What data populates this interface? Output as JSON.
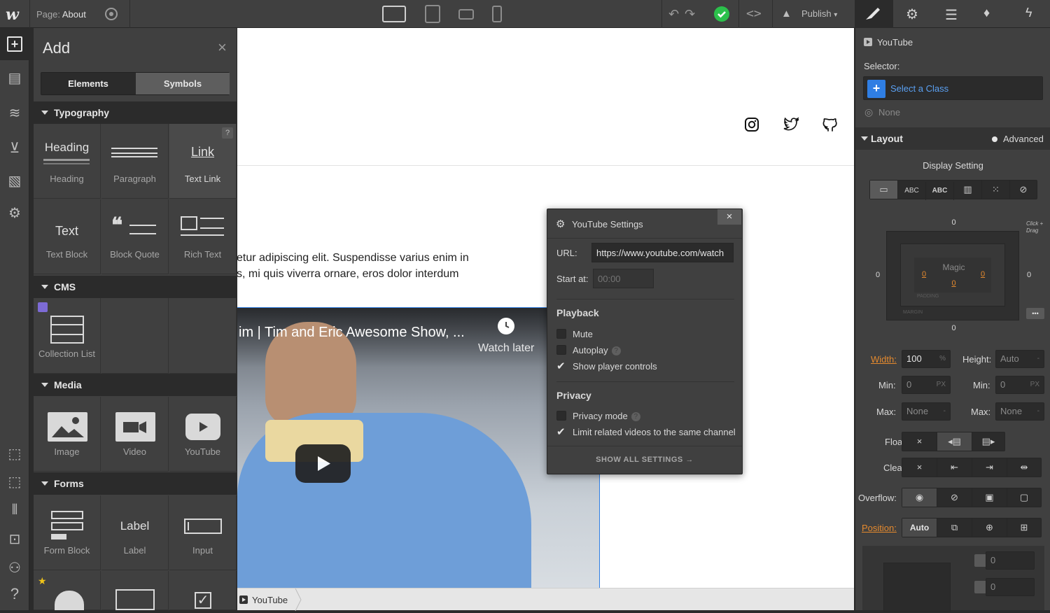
{
  "topbar": {
    "logo": "w",
    "page_prefix": "Page:",
    "page_name": "About",
    "publish_label": "Publish",
    "status_color": "#2bc04b"
  },
  "add_panel": {
    "title": "Add",
    "tabs": [
      "Elements",
      "Symbols"
    ],
    "help_badge": "?",
    "sections": {
      "typography": {
        "label": "Typography",
        "items": [
          {
            "visual": "Heading",
            "label": "Heading"
          },
          {
            "visual": "",
            "label": "Paragraph"
          },
          {
            "visual": "Link",
            "label": "Text Link"
          },
          {
            "visual": "Text",
            "label": "Text Block"
          },
          {
            "visual": "",
            "label": "Block Quote"
          },
          {
            "visual": "",
            "label": "Rich Text"
          }
        ]
      },
      "cms": {
        "label": "CMS",
        "items": [
          {
            "label": "Collection List"
          }
        ]
      },
      "media": {
        "label": "Media",
        "items": [
          {
            "label": "Image"
          },
          {
            "label": "Video"
          },
          {
            "label": "YouTube"
          }
        ]
      },
      "forms": {
        "label": "Forms",
        "items": [
          {
            "visual": "",
            "label": "Form Block"
          },
          {
            "visual": "Label",
            "label": "Label"
          },
          {
            "visual": "",
            "label": "Input"
          }
        ]
      }
    }
  },
  "canvas": {
    "paragraph_line1": "etur adipiscing elit. Suspendisse varius enim in",
    "paragraph_line2": "s, mi quis viverra ornare, eros dolor interdum",
    "video_title": "im | Tim and Eric Awesome Show, ...",
    "watch_later": "Watch later"
  },
  "breadcrumb": {
    "label": "YouTube"
  },
  "youtube_settings": {
    "title": "YouTube Settings",
    "url_label": "URL:",
    "url_value": "https://www.youtube.com/watch",
    "start_label": "Start at:",
    "start_placeholder": "00:00",
    "playback_heading": "Playback",
    "mute_label": "Mute",
    "autoplay_label": "Autoplay",
    "controls_label": "Show player controls",
    "privacy_heading": "Privacy",
    "privacy_mode_label": "Privacy mode",
    "limit_label": "Limit related videos to the same channel",
    "show_all_label": "SHOW ALL SETTINGS →",
    "checks": {
      "mute": false,
      "autoplay": false,
      "controls": true,
      "privacy_mode": false,
      "limit": true
    }
  },
  "style_panel": {
    "element_name": "YouTube",
    "selector_label": "Selector:",
    "select_class_label": "Select a Class",
    "none_label": "None",
    "layout_heading": "Layout",
    "advanced_label": "Advanced",
    "display_heading": "Display Setting",
    "display_options": [
      "",
      "ABC",
      "ABC",
      "",
      "",
      ""
    ],
    "box": {
      "margin_top": "0",
      "margin_bottom": "0",
      "margin_left": "0",
      "margin_right": "0",
      "magic_label": "Magic",
      "padding_top": "0",
      "padding_left": "0",
      "padding_right": "0",
      "padding_label": "PADDING",
      "margin_label": "MARGIN",
      "click_drag": "Click + Drag",
      "more": "•••"
    },
    "width_label": "Width:",
    "width_value": "100",
    "width_unit": "%",
    "height_label": "Height:",
    "height_value": "Auto",
    "min_label": "Min:",
    "min_w_value": "0",
    "min_h_value": "0",
    "min_unit": "PX",
    "max_label": "Max:",
    "max_w_value": "None",
    "max_h_value": "None",
    "dash": "-",
    "float_label": "Float:",
    "clear_label": "Clear:",
    "overflow_label": "Overflow:",
    "position_label": "Position:",
    "position_value": "Auto",
    "x_mark": "×",
    "pos_values": [
      "0",
      "0"
    ]
  },
  "colors": {
    "accent_blue": "#2f7ee3",
    "orange_label": "#e58a2e",
    "canvas_bg": "#ffffff",
    "panel_bg": "#404040"
  }
}
